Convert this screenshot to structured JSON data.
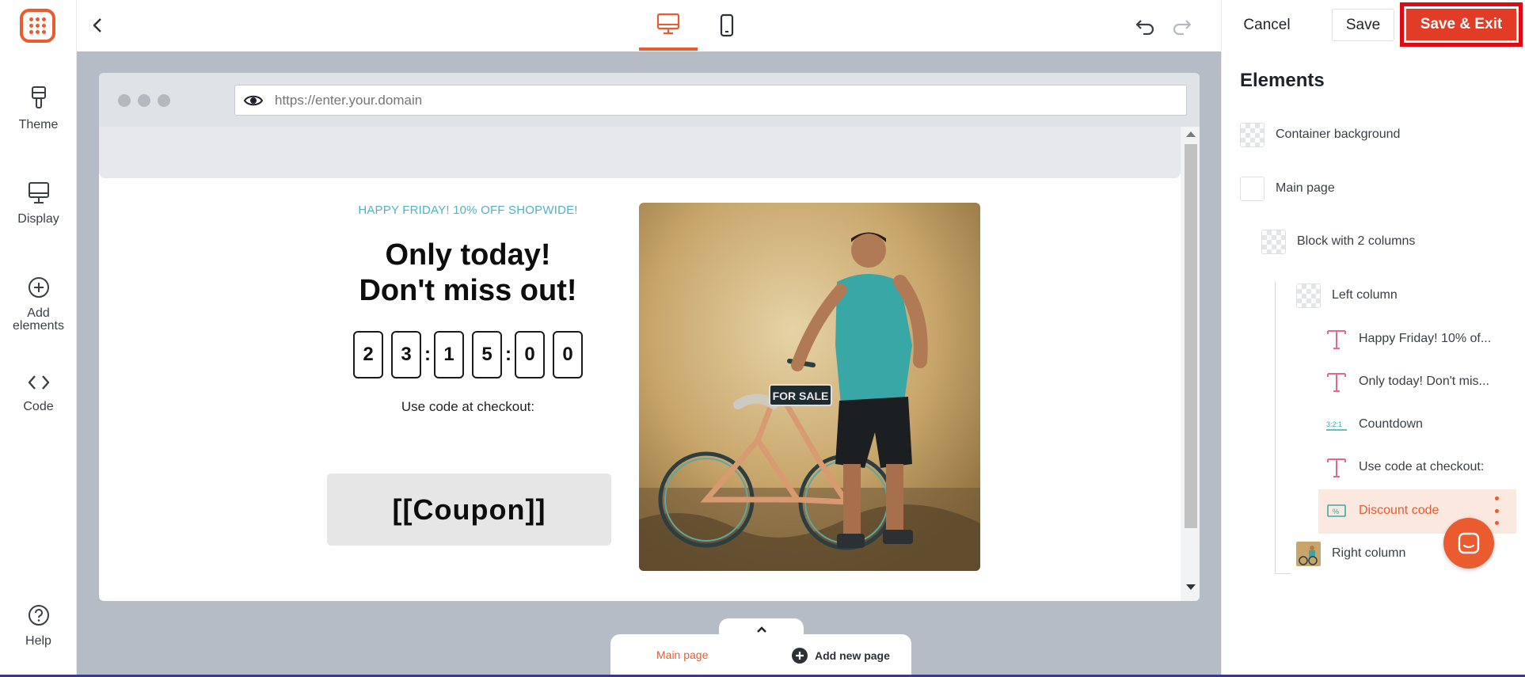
{
  "sidebar": {
    "items": [
      {
        "label": "Theme",
        "icon": "brush-icon"
      },
      {
        "label": "Display",
        "icon": "monitor-icon"
      },
      {
        "label": "Add elements",
        "icon": "plus-circle-icon"
      },
      {
        "label": "Code",
        "icon": "code-icon"
      },
      {
        "label": "Help",
        "icon": "help-icon"
      }
    ]
  },
  "toolbar": {
    "cancel_label": "Cancel",
    "save_label": "Save",
    "save_exit_label": "Save & Exit",
    "active_device": "desktop"
  },
  "preview": {
    "url_placeholder": "https://enter.your.domain",
    "eyebrow": "HAPPY FRIDAY! 10% OFF SHOPWIDE!",
    "title": "Only today!\nDon't miss out!",
    "countdown": [
      "2",
      "3",
      "1",
      "5",
      "0",
      "0"
    ],
    "use_code": "Use code at checkout:",
    "coupon": "[[Coupon]]",
    "photo_sign": "FOR SALE"
  },
  "pages": {
    "main_label": "Main page",
    "add_label": "Add new page"
  },
  "elements_panel": {
    "title": "Elements",
    "items": [
      {
        "label": "Container background"
      },
      {
        "label": "Main page"
      },
      {
        "label": "Block with 2 columns"
      },
      {
        "label": "Left column"
      },
      {
        "label": "Happy Friday! 10% of..."
      },
      {
        "label": "Only today! Don't mis..."
      },
      {
        "label": "Countdown"
      },
      {
        "label": "Use code at checkout:"
      },
      {
        "label": "Discount code"
      },
      {
        "label": "Right column"
      }
    ],
    "selected": "Discount code"
  },
  "colors": {
    "accent": "#ea5b2f",
    "save_exit_bg": "#e23b26",
    "eyebrow": "#4fb3c4",
    "canvas_bg": "#b5bcc6"
  }
}
